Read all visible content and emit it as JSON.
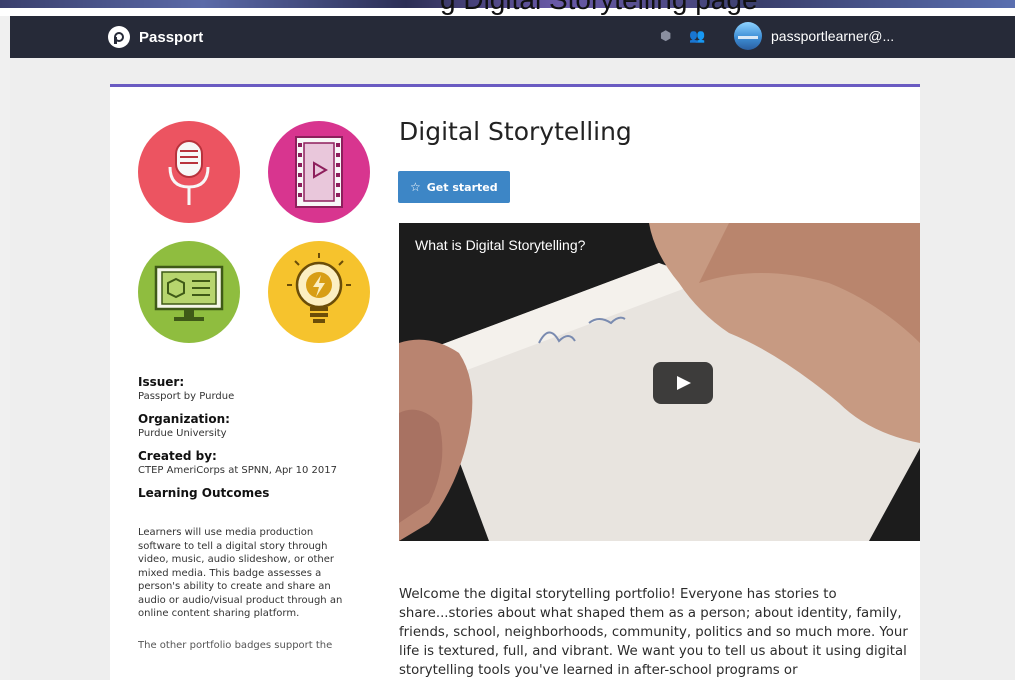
{
  "window": {
    "partial_top_text": "g   Digital Storytelling page"
  },
  "navbar": {
    "brand": "Passport",
    "icons": [
      "badge-icon",
      "people-icon"
    ],
    "username": "passportlearner@..."
  },
  "badge_images": [
    "microphone-icon",
    "film-strip-icon",
    "computer-monitor-icon",
    "lightbulb-icon"
  ],
  "details": {
    "issuer_label": "Issuer:",
    "issuer_value": "Passport by Purdue",
    "organization_label": "Organization:",
    "organization_value": "Purdue University",
    "created_label": "Created by:",
    "created_value": "CTEP AmeriCorps at SPNN, Apr 10 2017",
    "outcomes_title": "Learning Outcomes",
    "outcomes_text": "Learners will use media production software to tell a digital story through video, music, audio slideshow, or other mixed media. This badge assesses a person's ability to create and share an audio or audio/visual product through an online content sharing platform.",
    "outcomes_cutoff": "The other portfolio badges support the"
  },
  "main": {
    "title": "Digital Storytelling",
    "get_started_label": "Get started",
    "video_title": "What is Digital Storytelling?",
    "description": "Welcome the digital storytelling portfolio! Everyone has stories to share...stories about what shaped them as a person; about identity, family, friends, school, neighborhoods, community, politics and so much more. Your life is textured, full, and vibrant. We want you to tell us about it using digital storytelling tools you've learned in after-school programs or"
  },
  "colors": {
    "navbar": "#262a38",
    "accent": "#6a5bc2",
    "button": "#3d86c6",
    "badge_red": "#ec5461",
    "badge_pink": "#d8358f",
    "badge_green": "#8fbd3f",
    "badge_yellow": "#f6c32d"
  }
}
